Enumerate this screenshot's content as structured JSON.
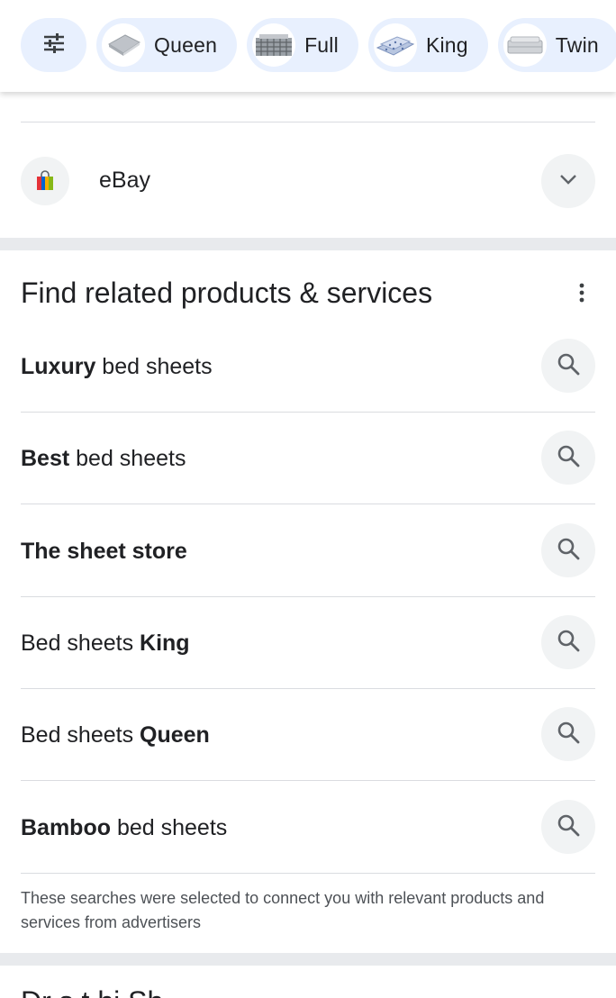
{
  "filter_bar": {
    "tune_icon": "tune-icon",
    "chips": [
      {
        "label": "Queen",
        "thumb": "flat-sheet-thumbnail"
      },
      {
        "label": "Full",
        "thumb": "plaid-sheet-thumbnail"
      },
      {
        "label": "King",
        "thumb": "blue-print-sheet-thumbnail"
      },
      {
        "label": "Twin",
        "thumb": "grey-sheet-thumbnail"
      }
    ]
  },
  "merchant": {
    "name": "eBay",
    "logo": "ebay-shopping-bag-logo",
    "expand_icon": "chevron-down-icon"
  },
  "related": {
    "title": "Find related products & services",
    "more_icon": "more-vert-icon",
    "items": [
      {
        "bold_prefix": "Luxury",
        "text": " bed sheets",
        "bold_suffix": ""
      },
      {
        "bold_prefix": "Best",
        "text": " bed sheets",
        "bold_suffix": ""
      },
      {
        "bold_prefix": "The sheet store",
        "text": "",
        "bold_suffix": ""
      },
      {
        "bold_prefix": "",
        "text": "Bed sheets ",
        "bold_suffix": "King"
      },
      {
        "bold_prefix": "",
        "text": "Bed sheets ",
        "bold_suffix": "Queen"
      },
      {
        "bold_prefix": "Bamboo",
        "text": " bed sheets",
        "bold_suffix": ""
      }
    ],
    "search_icon": "search-icon",
    "disclaimer": "These searches were selected to connect you with relevant products and services from advertisers"
  },
  "next_section": {
    "title_partial": "Dr s   t  hi   Sh"
  },
  "colors": {
    "chip_bg": "#e8f0fe",
    "button_bg": "#f1f3f4",
    "divider": "#dadce0",
    "band": "#e8eaed",
    "text": "#202124",
    "secondary_text": "#4d5156"
  }
}
